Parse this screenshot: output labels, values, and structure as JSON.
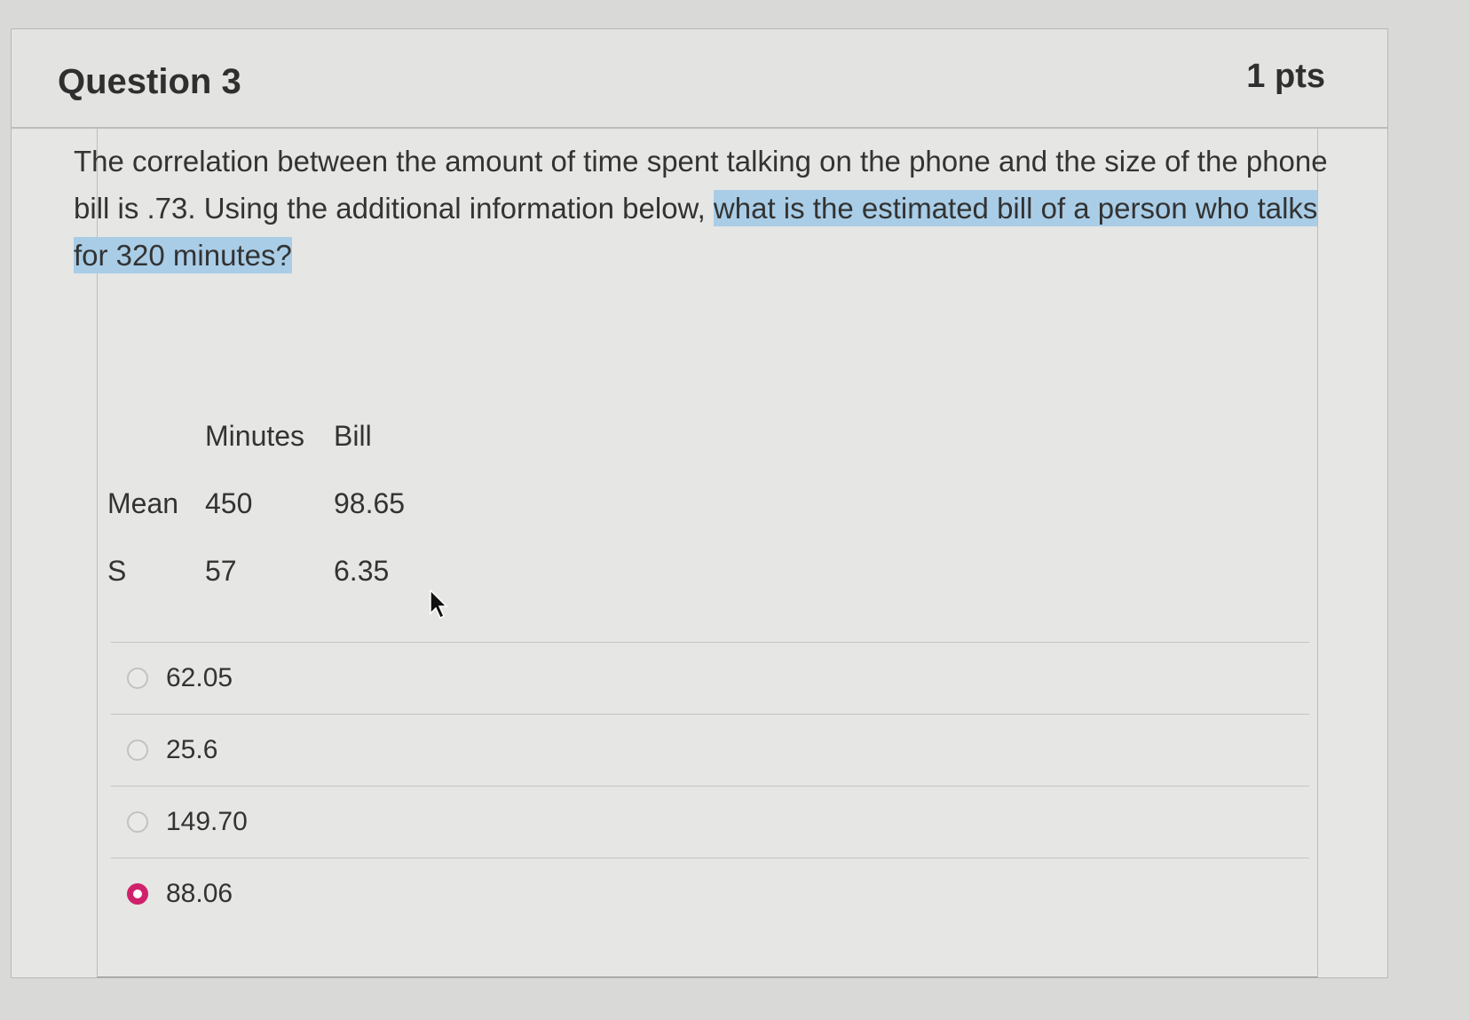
{
  "question": {
    "title": "Question 3",
    "points": "1 pts",
    "text_plain": "The correlation between the amount of time spent talking on the phone and the size of the phone bill is .73. Using the additional information below, ",
    "text_highlighted": "what is the estimated bill of a person who talks for 320 minutes?"
  },
  "table": {
    "headers": [
      "",
      "Minutes",
      "Bill"
    ],
    "rows": [
      [
        "Mean",
        "450",
        "98.65"
      ],
      [
        "S",
        "57",
        "6.35"
      ]
    ]
  },
  "answers": [
    {
      "label": "62.05",
      "selected": false
    },
    {
      "label": "25.6",
      "selected": false
    },
    {
      "label": "149.70",
      "selected": false
    },
    {
      "label": "88.06",
      "selected": true
    }
  ],
  "colors": {
    "selected_radio": "#d0216c",
    "highlight": "#a9cde7"
  }
}
